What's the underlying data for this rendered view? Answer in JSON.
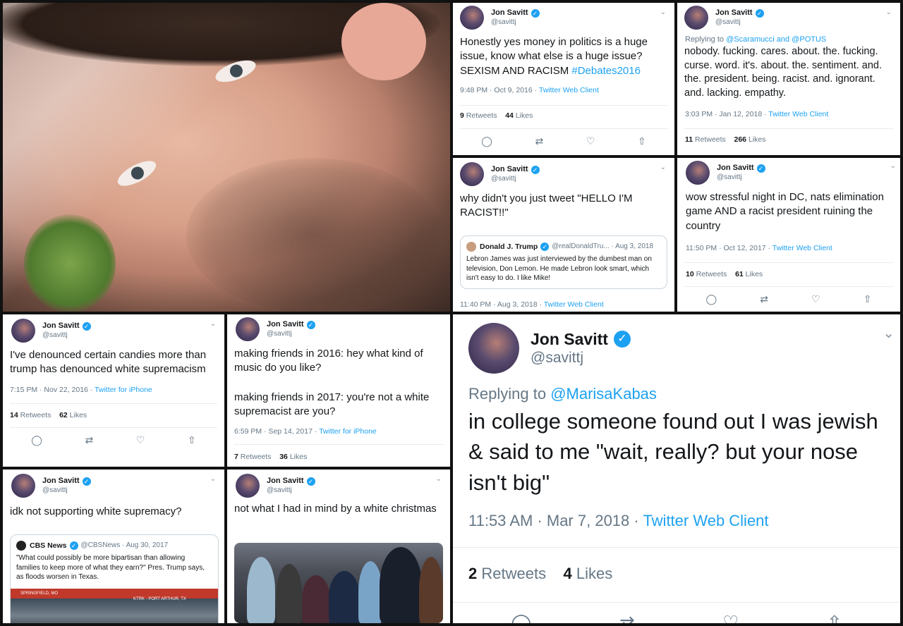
{
  "user": {
    "name": "Jon Savitt",
    "handle": "@savittj"
  },
  "tweets": {
    "t1": {
      "text_plain": "Honestly yes money in politics is a huge issue, know what else is a huge issue? SEXISM AND RACISM ",
      "hashtag": "#Debates2016",
      "time": "9:48 PM · Oct 9, 2016 · ",
      "client": "Twitter Web Client",
      "retweets": "9",
      "likes": "44"
    },
    "t2": {
      "reply_prefix": "Replying to ",
      "reply_to": "@Scaramucci and @POTUS",
      "text": "nobody. fucking. cares. about. the. fucking. curse. word. it's. about. the. sentiment. and. the. president. being. racist. and. ignorant. and. lacking. empathy.",
      "time": "3:03 PM · Jan 12, 2018 · ",
      "client": "Twitter Web Client",
      "retweets": "11",
      "likes": "266"
    },
    "t3": {
      "text": "why didn't you just tweet \"HELLO I'M RACIST!!\"",
      "quote_name": "Donald J. Trump",
      "quote_meta": "@realDonaldTru... · Aug 3, 2018",
      "quote_text": "Lebron James was just interviewed by the dumbest man on television, Don Lemon. He made Lebron look smart, which isn't easy to do. I like Mike!",
      "time": "11:40 PM · Aug 3, 2018 · ",
      "client": "Twitter Web Client"
    },
    "t4": {
      "text": "wow stressful night in DC, nats elimination game AND a racist president ruining the country",
      "time": "11:50 PM · Oct 12, 2017 · ",
      "client": "Twitter Web Client",
      "retweets": "10",
      "likes": "61"
    },
    "t5": {
      "text": "I've denounced certain candies more than trump has denounced white supremacism",
      "time": "7:15 PM · Nov 22, 2016 · ",
      "client": "Twitter for iPhone",
      "retweets": "14",
      "likes": "62"
    },
    "t6": {
      "text1": "making friends in 2016: hey what kind of music do you like?",
      "text2": "making friends in 2017: you're not a white supremacist are you?",
      "time": "6:59 PM · Sep 14, 2017 · ",
      "client": "Twitter for iPhone",
      "retweets": "7",
      "likes": "36"
    },
    "t7": {
      "text": "idk not supporting white supremacy?",
      "quote_name": "CBS News",
      "quote_meta": "@CBSNews · Aug 30, 2017",
      "quote_text": "\"What could possibly be more bipartisan than allowing families to keep more of what they earn?\" Pres. Trump says, as floods worsen in Texas.",
      "img_left": "SPRINGFIELD, MO",
      "img_right": "KTRK - PORT ARTHUR, TX"
    },
    "t8": {
      "text": "not what I had in mind by a white christmas"
    },
    "t9": {
      "reply_prefix": "Replying to ",
      "reply_to": "@MarisaKabas",
      "text": "in college someone found out I was jewish & said to me \"wait, really? but your nose isn't big\"",
      "time": "11:53 AM · Mar 7, 2018 · ",
      "client": "Twitter Web Client",
      "retweets": "2",
      "likes": "4"
    }
  },
  "labels": {
    "retweets": "Retweets",
    "likes": "Likes"
  },
  "icons": {
    "reply": "reply-icon",
    "retweet": "retweet-icon",
    "like": "heart-icon",
    "share": "share-icon",
    "verified": "verified-icon",
    "chevron": "chevron-down-icon"
  },
  "colors": {
    "link": "#1da1f2",
    "muted": "#657786",
    "text": "#14171a",
    "verified": "#1da1f2"
  }
}
